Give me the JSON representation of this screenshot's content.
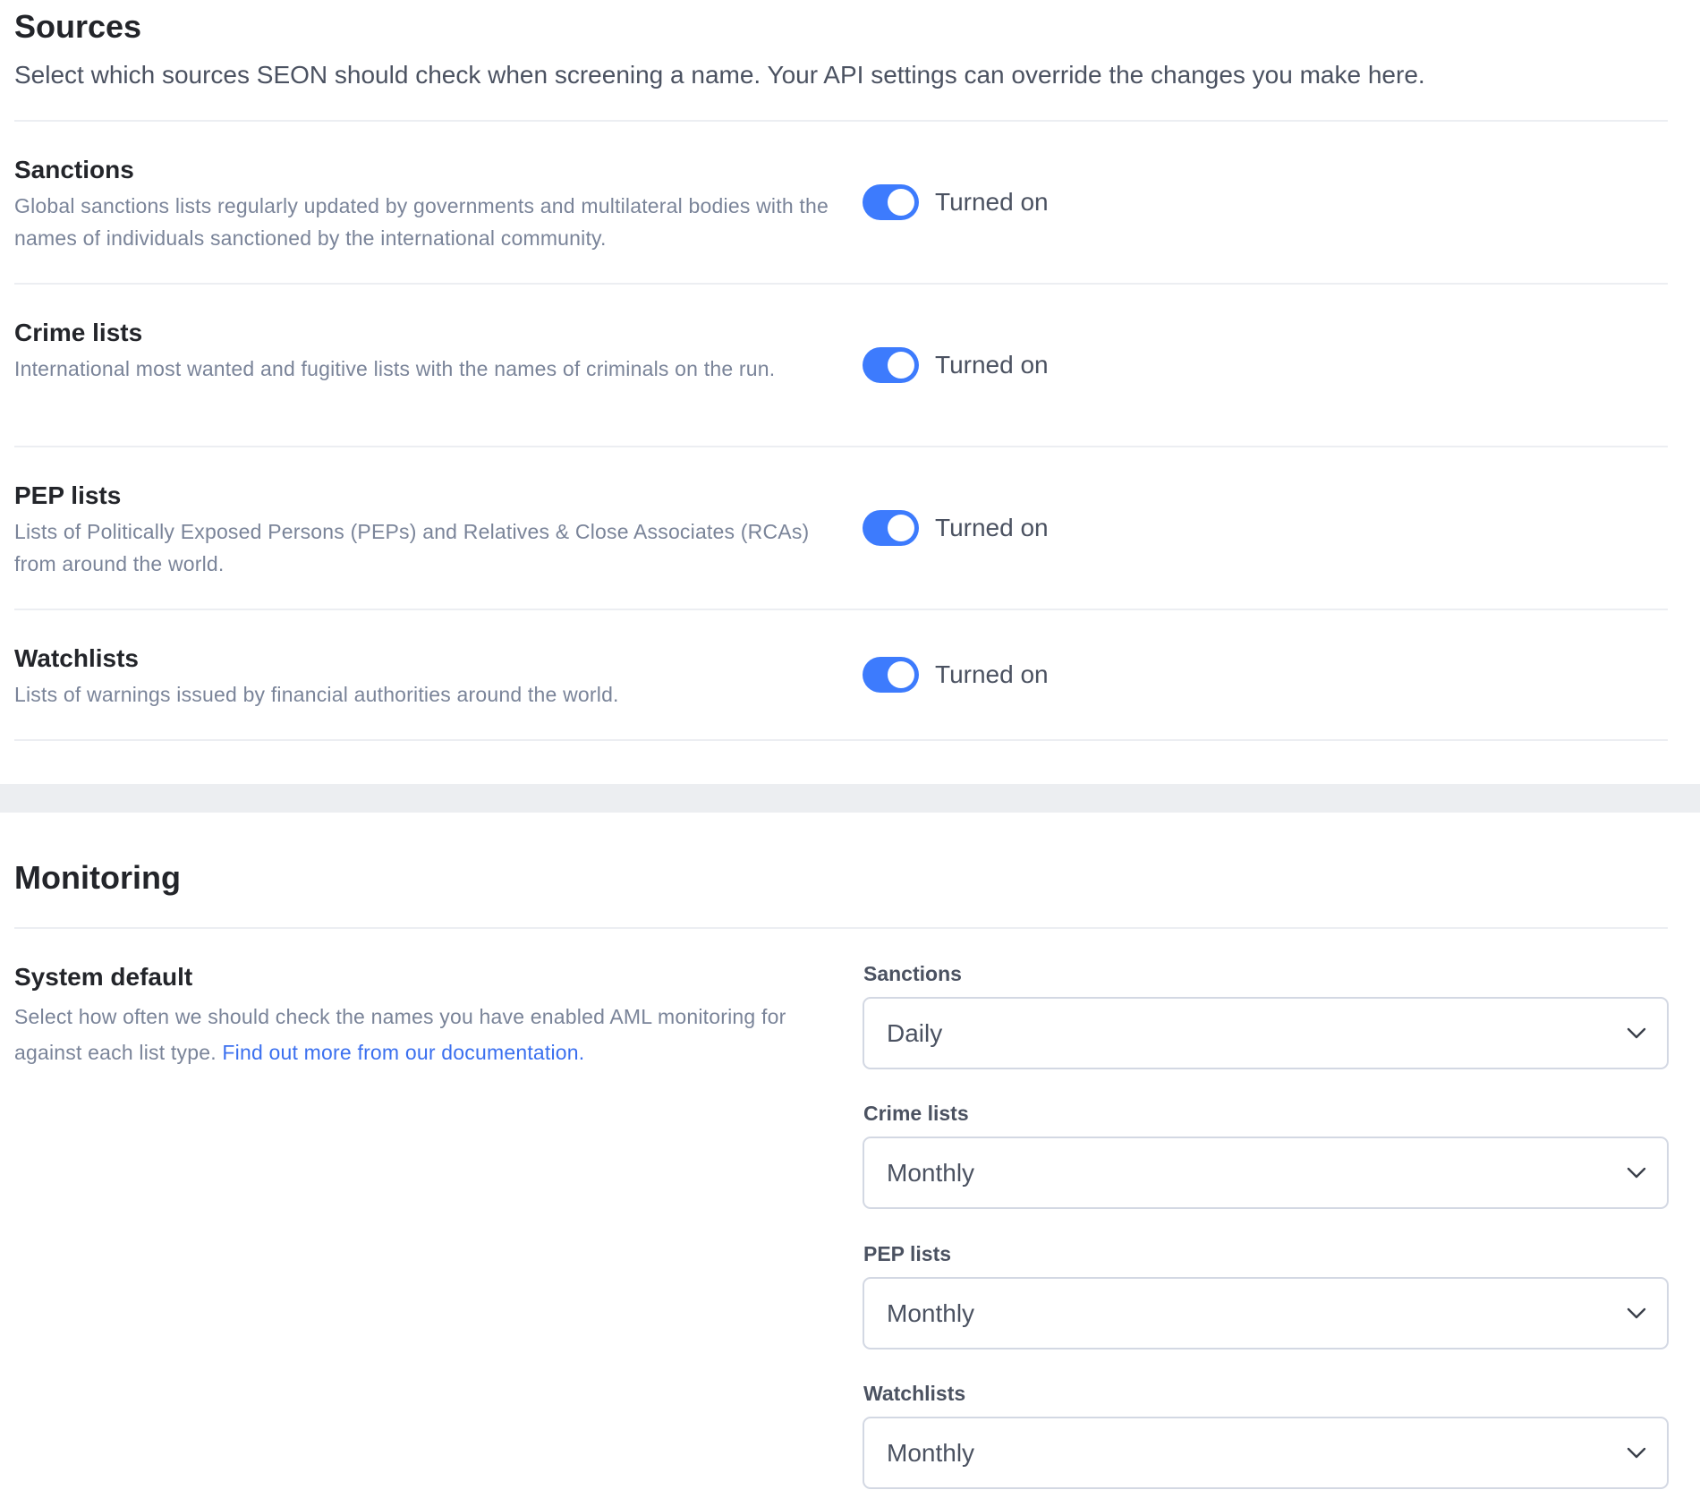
{
  "sources": {
    "title": "Sources",
    "subtitle": "Select which sources SEON should check when screening a name. Your API settings can override the changes you make here.",
    "items": [
      {
        "title": "Sanctions",
        "description": "Global sanctions lists regularly updated by governments and multilateral bodies with the names of individuals sanctioned by the international community.",
        "enabled": true,
        "status_label": "Turned on"
      },
      {
        "title": "Crime lists",
        "description": "International most wanted and fugitive lists with the names of criminals on the run.",
        "enabled": true,
        "status_label": "Turned on"
      },
      {
        "title": "PEP lists",
        "description": "Lists of Politically Exposed Persons (PEPs) and Relatives & Close Associates (RCAs) from around the world.",
        "enabled": true,
        "status_label": "Turned on"
      },
      {
        "title": "Watchlists",
        "description": "Lists of warnings issued by financial authorities around the world.",
        "enabled": true,
        "status_label": "Turned on"
      }
    ]
  },
  "monitoring": {
    "title": "Monitoring",
    "system_default": {
      "title": "System default",
      "description": "Select how often we should check the names you have enabled AML monitoring for against each list type.",
      "link_text": "Find out more from our documentation."
    },
    "fields": [
      {
        "label": "Sanctions",
        "value": "Daily"
      },
      {
        "label": "Crime lists",
        "value": "Monthly"
      },
      {
        "label": "PEP lists",
        "value": "Monthly"
      },
      {
        "label": "Watchlists",
        "value": "Monthly"
      }
    ]
  },
  "colors": {
    "accent": "#3d7bfd",
    "link": "#3b70ef",
    "description_text": "#7a8499",
    "divider": "#eceef2"
  }
}
